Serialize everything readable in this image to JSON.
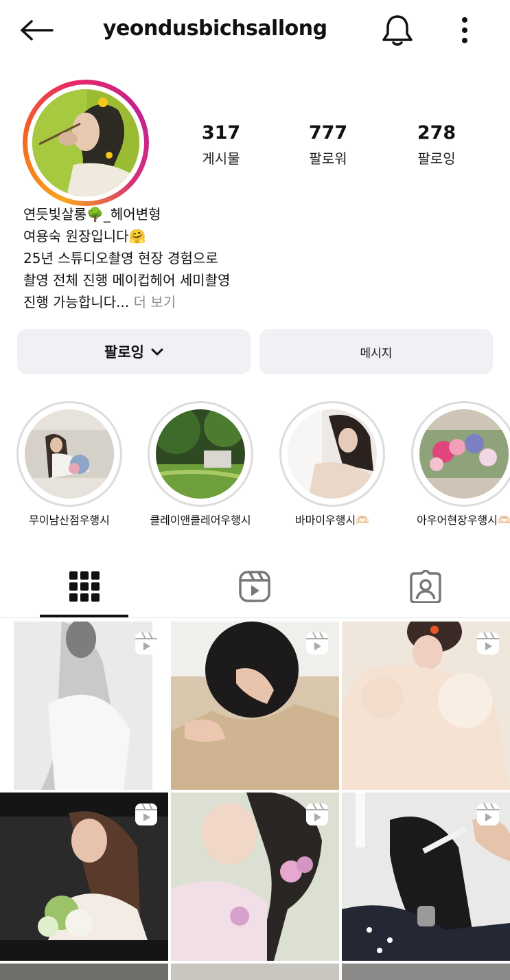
{
  "header": {
    "username": "yeondusbichsallong",
    "icons": {
      "back": "arrow-left-icon",
      "notifications": "bell-icon",
      "more": "more-vertical-icon"
    }
  },
  "profile": {
    "stats": [
      {
        "value": "317",
        "label": "게시물"
      },
      {
        "value": "777",
        "label": "팔로워"
      },
      {
        "value": "278",
        "label": "팔로잉"
      }
    ],
    "bio_lines": [
      "연듯빛살롱🌳_헤어변형",
      "여용숙 원장입니다🤗",
      "25년 스튜디오촬영 현장 경험으로",
      "촬영 전체 진행 메이컵헤어 세미촬영",
      "진행 가능합니다..."
    ],
    "bio_more": " 더 보기"
  },
  "actions": {
    "follow_label": "팔로잉",
    "message_label": "메시지"
  },
  "highlights": [
    {
      "label": "무이남산점우행시"
    },
    {
      "label": "클레이앤클레어우행시"
    },
    {
      "label": "바마이우행시🫶🏻"
    },
    {
      "label": "아우어현장우행시🫶🏻"
    }
  ],
  "tabs": {
    "icons": [
      "grid-icon",
      "reels-icon",
      "tagged-icon"
    ],
    "active": "grid"
  },
  "colors": {
    "button_bg": "#eff1f4",
    "muted_text": "#8e8e8e",
    "ring_gradient": [
      "#f9a31d",
      "#e92a64",
      "#c3218f"
    ]
  }
}
